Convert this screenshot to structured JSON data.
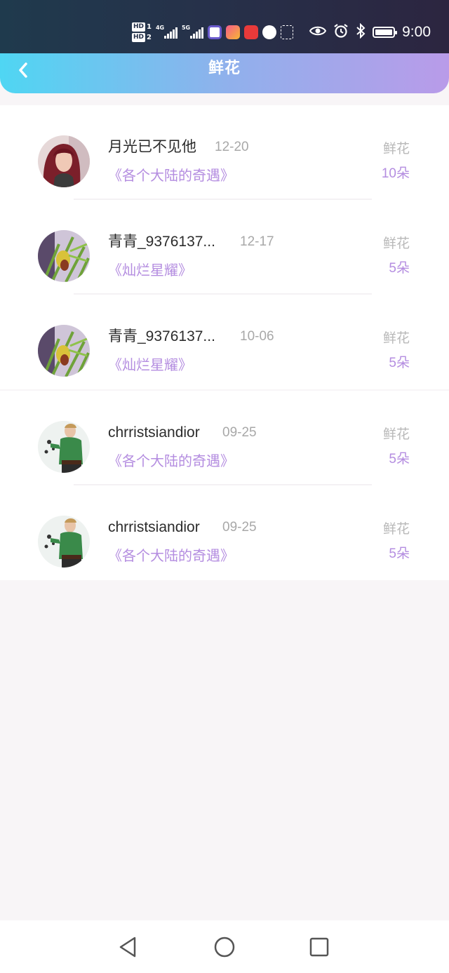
{
  "status_bar": {
    "time": "9:00",
    "sim1_label": "HD",
    "sim1_num": "1",
    "sim2_label": "HD",
    "sim2_num": "2",
    "net1": "4G",
    "net2": "5G",
    "icons": [
      "signal-4g-icon",
      "signal-5g-icon",
      "app-icon",
      "app-icon",
      "huawei-app-icon",
      "app-icon",
      "app-icon",
      "eye-icon",
      "alarm-icon",
      "bluetooth-icon",
      "battery-icon"
    ]
  },
  "header": {
    "title": "鲜花",
    "back_icon": "chevron-left-icon"
  },
  "list": [
    {
      "name": "月光已不见他",
      "date": "12-20",
      "book": "《各个大陆的奇遇》",
      "tag": "鲜花",
      "count": "10朵",
      "avatar": "girl"
    },
    {
      "name": "青青_9376137...",
      "date": "12-17",
      "book": "《灿烂星耀》",
      "tag": "鲜花",
      "count": "5朵",
      "avatar": "plant"
    },
    {
      "name": "青青_9376137...",
      "date": "10-06",
      "book": "《灿烂星耀》",
      "tag": "鲜花",
      "count": "5朵",
      "avatar": "plant"
    },
    {
      "name": "chrristsiandior",
      "date": "09-25",
      "book": "《各个大陆的奇遇》",
      "tag": "鲜花",
      "count": "5朵",
      "avatar": "man"
    },
    {
      "name": "chrristsiandior",
      "date": "09-25",
      "book": "《各个大陆的奇遇》",
      "tag": "鲜花",
      "count": "5朵",
      "avatar": "man"
    }
  ],
  "nav": {
    "back": "triangle-back-icon",
    "home": "circle-home-icon",
    "recents": "square-recents-icon"
  },
  "colors": {
    "header_start": "#4fd6f3",
    "header_end": "#b99be9",
    "accent_purple": "#b48de0",
    "muted_gray": "#a8a8a8"
  }
}
